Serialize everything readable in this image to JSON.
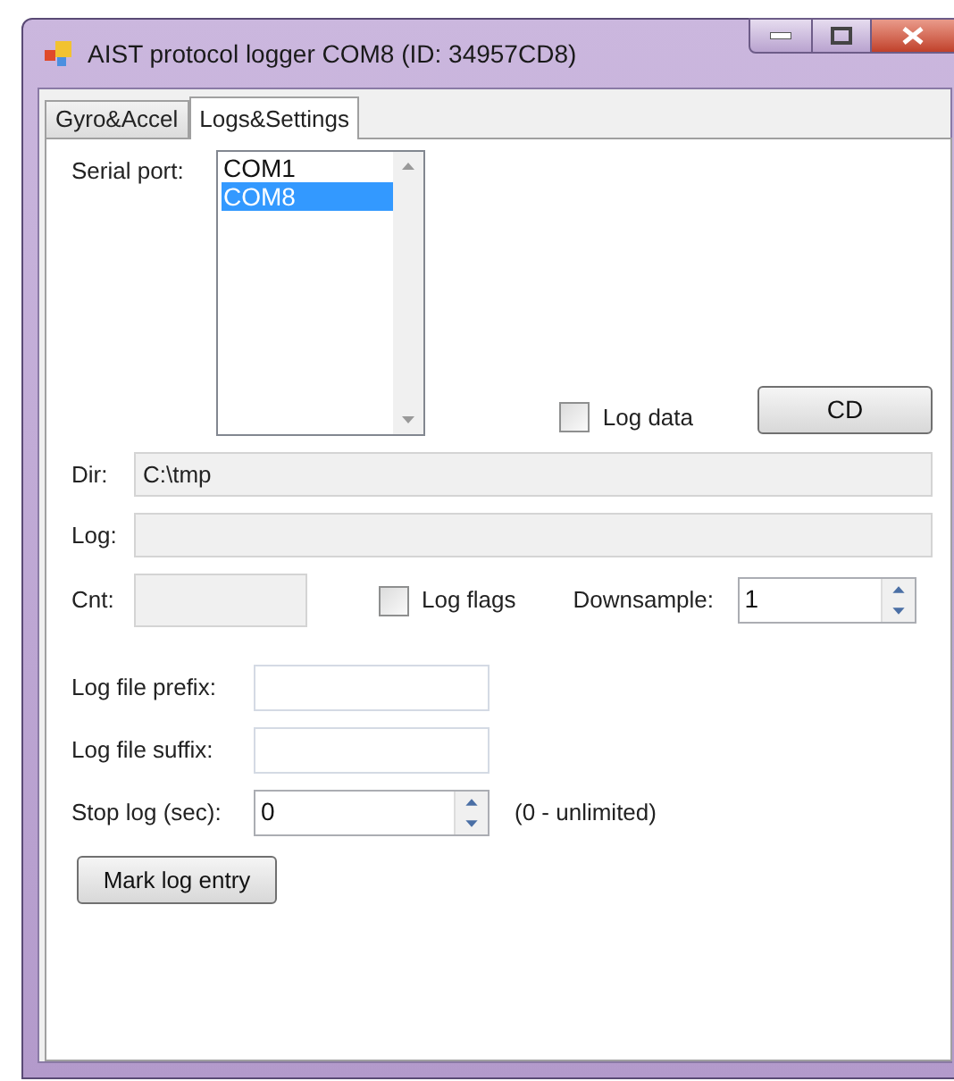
{
  "window": {
    "title": "AIST protocol logger COM8 (ID: 34957CD8)"
  },
  "tabs": [
    {
      "label": "Gyro&Accel",
      "selected": false
    },
    {
      "label": "Logs&Settings",
      "selected": true
    }
  ],
  "serial_port": {
    "label": "Serial port:",
    "items": [
      {
        "label": "COM1",
        "selected": false
      },
      {
        "label": "COM8",
        "selected": true
      }
    ]
  },
  "log_data": {
    "label": "Log data",
    "checked": false
  },
  "cd_button": "CD",
  "dir": {
    "label": "Dir:",
    "value": "C:\\tmp"
  },
  "log": {
    "label": "Log:"
  },
  "cnt": {
    "label": "Cnt:"
  },
  "log_flags": {
    "label": "Log flags",
    "checked": false
  },
  "downsample": {
    "label": "Downsample:",
    "value": "1"
  },
  "log_file_prefix": {
    "label": "Log file prefix:"
  },
  "log_file_suffix": {
    "label": "Log file suffix:"
  },
  "stop_log": {
    "label": "Stop log (sec):",
    "value": "0",
    "hint": "(0 - unlimited)"
  },
  "mark_button": "Mark log entry"
}
